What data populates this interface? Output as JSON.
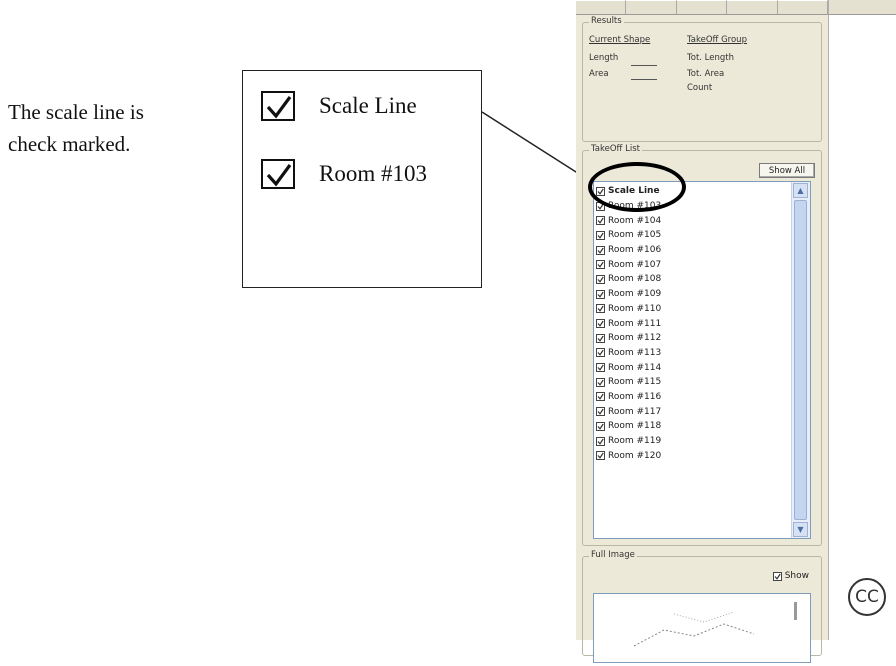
{
  "caption": {
    "line1": "The scale line is",
    "line2": "check marked."
  },
  "callout": {
    "item1": "Scale Line",
    "item2": "Room #103"
  },
  "panel": {
    "results": {
      "title": "Results",
      "current_shape": "Current Shape",
      "takeoff_group": "TakeOff Group",
      "length": "Length",
      "area": "Area",
      "tot_length": "Tot. Length",
      "tot_area": "Tot. Area",
      "count": "Count"
    },
    "takeoff_list": {
      "title": "TakeOff List",
      "show_all": "Show All",
      "items": [
        "Scale Line",
        "Room #103",
        "Room #104",
        "Room #105",
        "Room #106",
        "Room #107",
        "Room #108",
        "Room #109",
        "Room #110",
        "Room #111",
        "Room #112",
        "Room #113",
        "Room #114",
        "Room #115",
        "Room #116",
        "Room #117",
        "Room #118",
        "Room #119",
        "Room #120"
      ]
    },
    "full_image": {
      "title": "Full Image",
      "show": "Show"
    }
  },
  "canvas": {
    "badge": "CC"
  }
}
